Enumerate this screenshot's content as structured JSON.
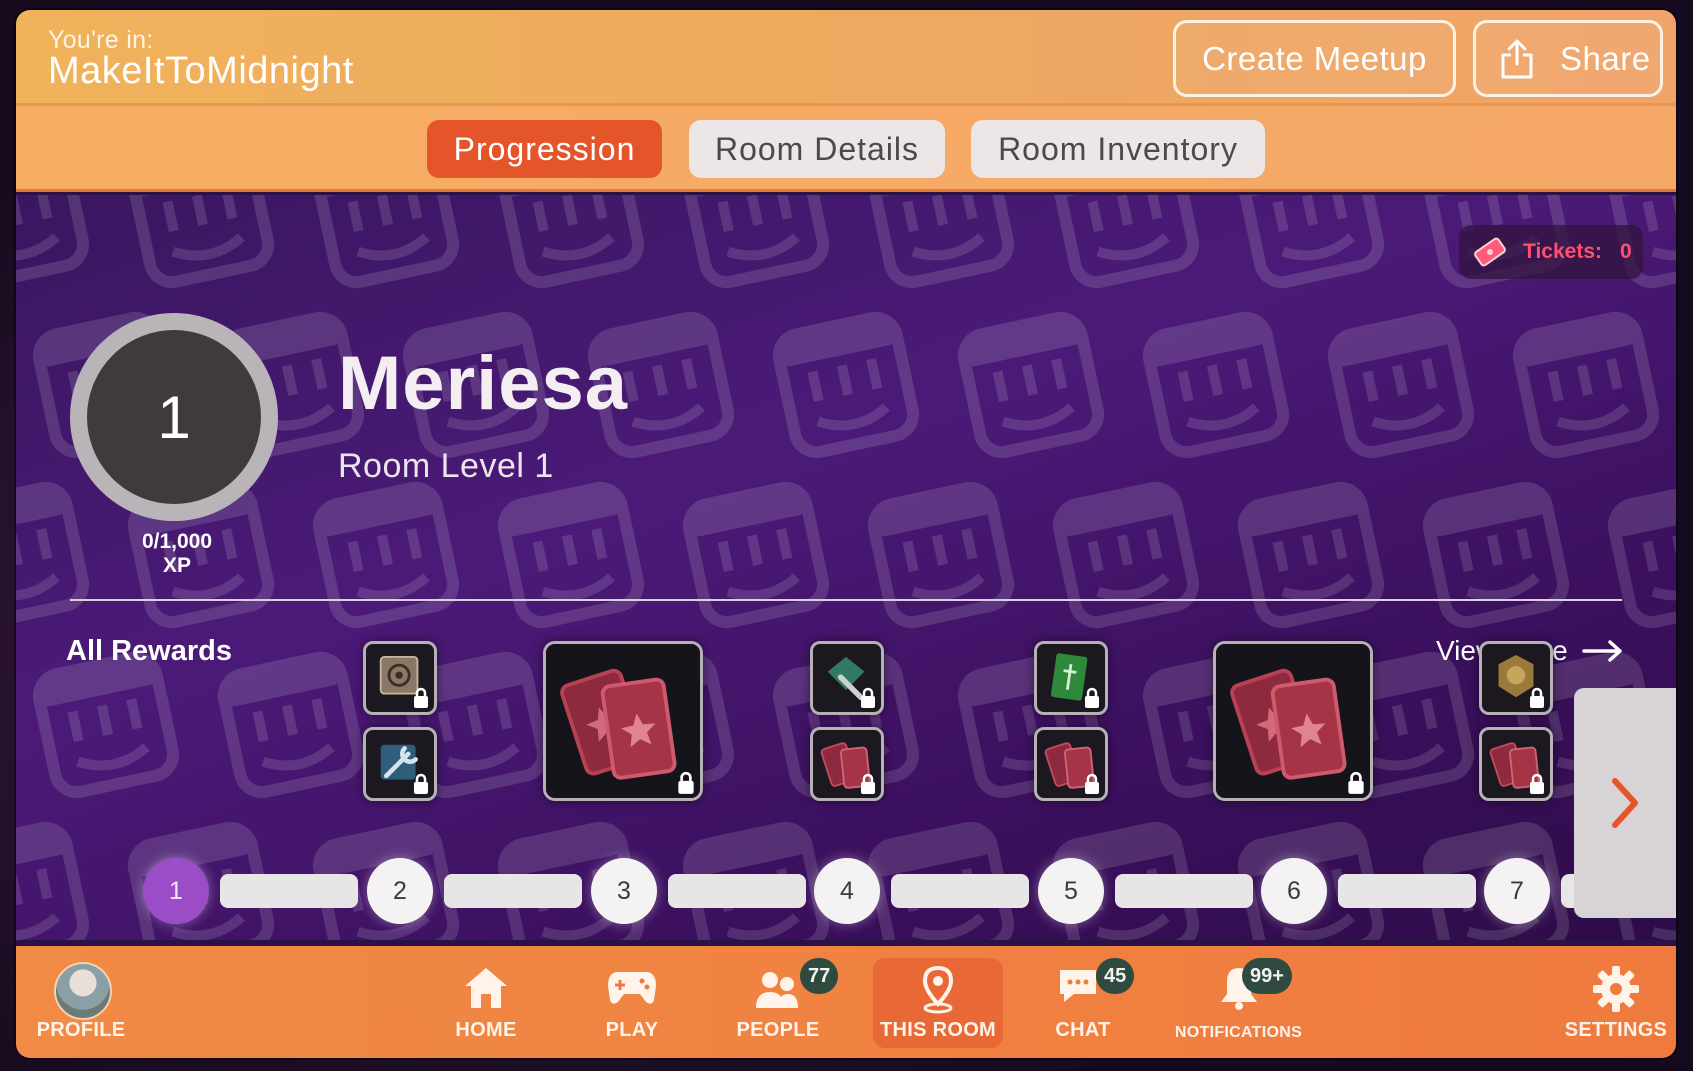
{
  "header": {
    "youre_in_label": "You're in:",
    "room_name": "MakeItToMidnight",
    "create_meetup_label": "Create Meetup",
    "share_label": "Share"
  },
  "tabs": [
    {
      "label": "Progression",
      "active": true
    },
    {
      "label": "Room Details",
      "active": false
    },
    {
      "label": "Room Inventory",
      "active": false
    }
  ],
  "tickets": {
    "label": "Tickets:",
    "count": "0"
  },
  "player": {
    "level": "1",
    "xp": "0/1,000",
    "xp_unit": "XP",
    "name": "Meriesa",
    "room_level": "Room Level 1"
  },
  "rewards": {
    "title": "All Rewards",
    "view_more": "View More",
    "levels": [
      "1",
      "2",
      "3",
      "4",
      "5",
      "6",
      "7"
    ],
    "current_level": 1
  },
  "nav": {
    "profile": "PROFILE",
    "home": "HOME",
    "play": "PLAY",
    "people": "PEOPLE",
    "people_badge": "77",
    "this_room": "THIS ROOM",
    "chat": "CHAT",
    "chat_badge": "45",
    "notifications": "NOTIFICATIONS",
    "notifications_badge": "99+",
    "settings": "SETTINGS"
  },
  "colors": {
    "header_orange": "#f0b25b",
    "active_tab": "#e4552a",
    "main_purple": "#4b1a78",
    "active_level": "#9a4dc6",
    "tickets_red": "#ff4f6e",
    "nav_orange": "#f18a45"
  }
}
